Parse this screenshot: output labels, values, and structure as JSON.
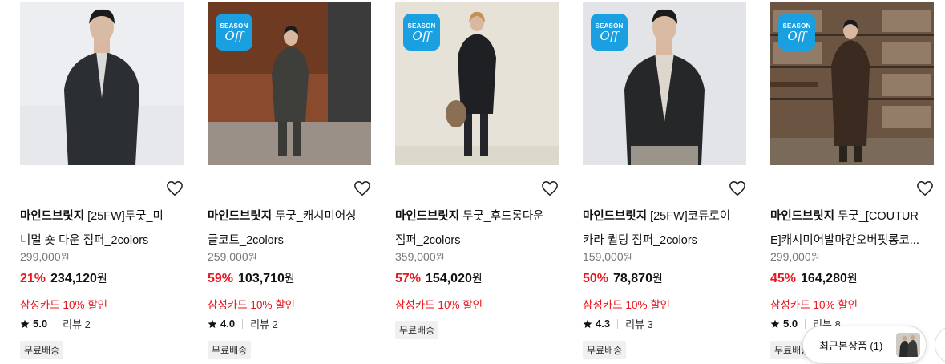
{
  "colors": {
    "discount": "#e8161e",
    "badge": "#1aa0e0",
    "free_shipping_bg": "#f0f0f0"
  },
  "badge": {
    "line1": "SEASON",
    "line2": "Off"
  },
  "products": [
    {
      "brand": "마인드브릿지",
      "name_line1": " [25FW]두굿_미",
      "name_line2": "니멀 숏 다운 점퍼_2colors",
      "original_price": "299,000",
      "discount_rate": "21%",
      "sale_price": "234,120",
      "won": "원",
      "card_discount": "삼성카드 10% 할인",
      "rating": "5.0",
      "reviews": "리뷰 2",
      "shipping": "무료배송",
      "badge": false,
      "icon": "heart-icon"
    },
    {
      "brand": "마인드브릿지",
      "name_line1": " 두굿_캐시미어싱",
      "name_line2": "글코트_2colors",
      "original_price": "259,000",
      "discount_rate": "59%",
      "sale_price": "103,710",
      "won": "원",
      "card_discount": "삼성카드 10% 할인",
      "rating": "4.0",
      "reviews": "리뷰 2",
      "shipping": "무료배송",
      "badge": true,
      "icon": "heart-icon"
    },
    {
      "brand": "마인드브릿지",
      "name_line1": " 두굿_후드롱다운",
      "name_line2": "점퍼_2colors",
      "original_price": "359,000",
      "discount_rate": "57%",
      "sale_price": "154,020",
      "won": "원",
      "card_discount": "삼성카드 10% 할인",
      "rating": "",
      "reviews": "",
      "shipping": "무료배송",
      "badge": true,
      "icon": "heart-icon"
    },
    {
      "brand": "마인드브릿지",
      "name_line1": " [25FW]코듀로이",
      "name_line2": "카라 퀼팅 점퍼_2colors",
      "original_price": "159,000",
      "discount_rate": "50%",
      "sale_price": "78,870",
      "won": "원",
      "card_discount": "삼성카드 10% 할인",
      "rating": "4.3",
      "reviews": "리뷰 3",
      "shipping": "무료배송",
      "badge": true,
      "icon": "heart-icon"
    },
    {
      "brand": "마인드브릿지",
      "name_line1": " 두굿_[COUTUR",
      "name_line2": "E]캐시미어발마칸오버핏롱코...",
      "original_price": "299,000",
      "discount_rate": "45%",
      "sale_price": "164,280",
      "won": "원",
      "card_discount": "삼성카드 10% 할인",
      "rating": "5.0",
      "reviews": "리뷰 8",
      "shipping": "무료배송",
      "badge": true,
      "icon": "heart-icon"
    }
  ],
  "recent_viewed": {
    "label": "최근본상품 (1)",
    "icon": "recent-thumbnail"
  }
}
